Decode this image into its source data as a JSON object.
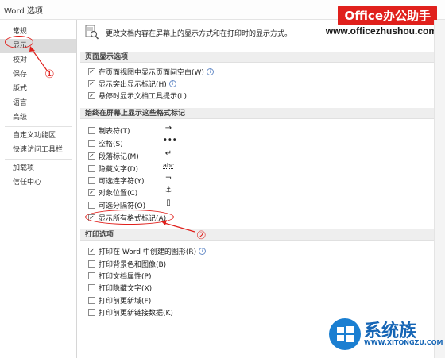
{
  "window": {
    "title": "Word 选项"
  },
  "watermark": {
    "brand": "Office办公助手",
    "url": "www.officezhushou.com"
  },
  "sidebar": {
    "items": [
      {
        "label": "常规"
      },
      {
        "label": "显示"
      },
      {
        "label": "校对"
      },
      {
        "label": "保存"
      },
      {
        "label": "版式"
      },
      {
        "label": "语言"
      },
      {
        "label": "高级"
      },
      {
        "label": "自定义功能区"
      },
      {
        "label": "快速访问工具栏"
      },
      {
        "label": "加载项"
      },
      {
        "label": "信任中心"
      }
    ],
    "selected": "显示"
  },
  "main": {
    "intro": "更改文档内容在屏幕上的显示方式和在打印时的显示方式。",
    "sections": {
      "page": {
        "header": "页面显示选项",
        "items": [
          {
            "label": "在页面视图中显示页面间空白(W)",
            "checked": true
          },
          {
            "label": "显示突出显示标记(H)",
            "checked": true
          },
          {
            "label": "悬停时显示文档工具提示(L)",
            "checked": true
          }
        ]
      },
      "marks": {
        "header": "始终在屏幕上显示这些格式标记",
        "items": [
          {
            "label": "制表符(T)",
            "checked": false,
            "symbol": "→"
          },
          {
            "label": "空格(S)",
            "checked": false,
            "symbol": "•••"
          },
          {
            "label": "段落标记(M)",
            "checked": true,
            "symbol": "↵"
          },
          {
            "label": "隐藏文字(D)",
            "checked": false,
            "symbol": "abc"
          },
          {
            "label": "可选连字符(Y)",
            "checked": false,
            "symbol": "¬"
          },
          {
            "label": "对象位置(C)",
            "checked": true,
            "symbol": "⚓"
          },
          {
            "label": "可选分隔符(O)",
            "checked": false,
            "symbol": "▯"
          },
          {
            "label": "显示所有格式标记(A)",
            "checked": true,
            "symbol": ""
          }
        ]
      },
      "print": {
        "header": "打印选项",
        "items": [
          {
            "label": "打印在 Word 中创建的图形(R)",
            "checked": true
          },
          {
            "label": "打印背景色和图像(B)",
            "checked": false
          },
          {
            "label": "打印文档属性(P)",
            "checked": false
          },
          {
            "label": "打印隐藏文字(X)",
            "checked": false
          },
          {
            "label": "打印前更新域(F)",
            "checked": false
          },
          {
            "label": "打印前更新链接数据(K)",
            "checked": false
          }
        ]
      }
    }
  },
  "annotations": {
    "step1": "①",
    "step2": "②"
  },
  "logo": {
    "text": "系统族",
    "sub": "WWW.XITONGZU.COM"
  },
  "colors": {
    "annotation": "#e0201c",
    "brand_bg": "#e0201c"
  }
}
